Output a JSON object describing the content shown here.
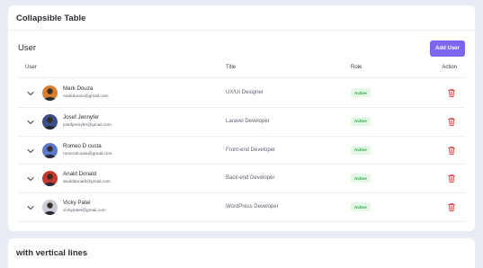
{
  "card1": {
    "title": "Collapsible Table",
    "section_title": "User",
    "add_button_label": "Add User",
    "columns": {
      "user": "User",
      "title": "Title",
      "role": "Role",
      "action": "Action"
    },
    "rows": [
      {
        "name": "Mark Douza",
        "email": "markdouza@gmail.com",
        "title": "UX/UI Designer",
        "role": "Active",
        "avatar_color": "#d9802f"
      },
      {
        "name": "Josef Jennyfer",
        "email": "josefjennyfer@gmail.com",
        "title": "Laravel Developer",
        "role": "Active",
        "avatar_color": "#3a4f8c"
      },
      {
        "name": "Romeo D custa",
        "email": "romeodcusta@gmail.com",
        "title": "Front-end Developer",
        "role": "Active",
        "avatar_color": "#5a79c9"
      },
      {
        "name": "Anald Donald",
        "email": "analddonald@gmail.com",
        "title": "Back-end Developer",
        "role": "Active",
        "avatar_color": "#c53a2e"
      },
      {
        "name": "Vicky Patel",
        "email": "vickypatel@gmail.com",
        "title": "WordPress Developer",
        "role": "Active",
        "avatar_color": "#c9ccd6"
      }
    ]
  },
  "card2": {
    "title": "with vertical lines"
  },
  "colors": {
    "accent": "#7b67ee",
    "badge_bg": "#e4f8e7",
    "badge_text": "#2ea143",
    "delete": "#e5484d",
    "page_bg": "#e9ecf5"
  }
}
